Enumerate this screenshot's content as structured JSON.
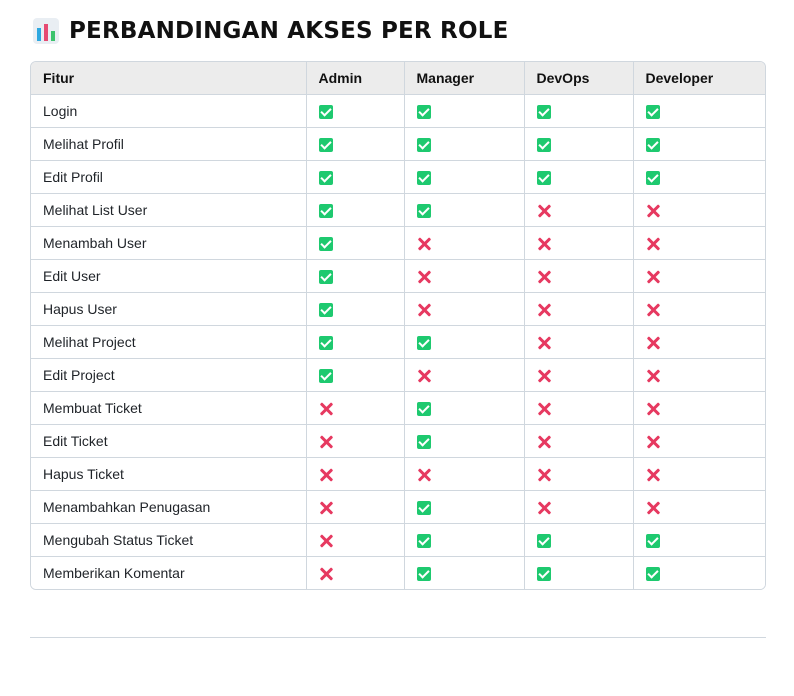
{
  "heading": {
    "title": "PERBANDINGAN AKSES PER ROLE",
    "icon": "bar-chart-icon"
  },
  "colors": {
    "allowed": "#1ec96f",
    "denied": "#e63960",
    "header_bg": "#ececec",
    "border": "#d0d7de"
  },
  "table": {
    "columns": [
      "Fitur",
      "Admin",
      "Manager",
      "DevOps",
      "Developer"
    ],
    "rows": [
      {
        "feature": "Login",
        "access": [
          true,
          true,
          true,
          true
        ]
      },
      {
        "feature": "Melihat Profil",
        "access": [
          true,
          true,
          true,
          true
        ]
      },
      {
        "feature": "Edit Profil",
        "access": [
          true,
          true,
          true,
          true
        ]
      },
      {
        "feature": "Melihat List User",
        "access": [
          true,
          true,
          false,
          false
        ]
      },
      {
        "feature": "Menambah User",
        "access": [
          true,
          false,
          false,
          false
        ]
      },
      {
        "feature": "Edit User",
        "access": [
          true,
          false,
          false,
          false
        ]
      },
      {
        "feature": "Hapus User",
        "access": [
          true,
          false,
          false,
          false
        ]
      },
      {
        "feature": "Melihat Project",
        "access": [
          true,
          true,
          false,
          false
        ]
      },
      {
        "feature": "Edit Project",
        "access": [
          true,
          false,
          false,
          false
        ]
      },
      {
        "feature": "Membuat Ticket",
        "access": [
          false,
          true,
          false,
          false
        ]
      },
      {
        "feature": "Edit Ticket",
        "access": [
          false,
          true,
          false,
          false
        ]
      },
      {
        "feature": "Hapus Ticket",
        "access": [
          false,
          false,
          false,
          false
        ]
      },
      {
        "feature": "Menambahkan Penugasan",
        "access": [
          false,
          true,
          false,
          false
        ]
      },
      {
        "feature": "Mengubah Status Ticket",
        "access": [
          false,
          true,
          true,
          true
        ]
      },
      {
        "feature": "Memberikan Komentar",
        "access": [
          false,
          true,
          true,
          true
        ]
      }
    ]
  }
}
